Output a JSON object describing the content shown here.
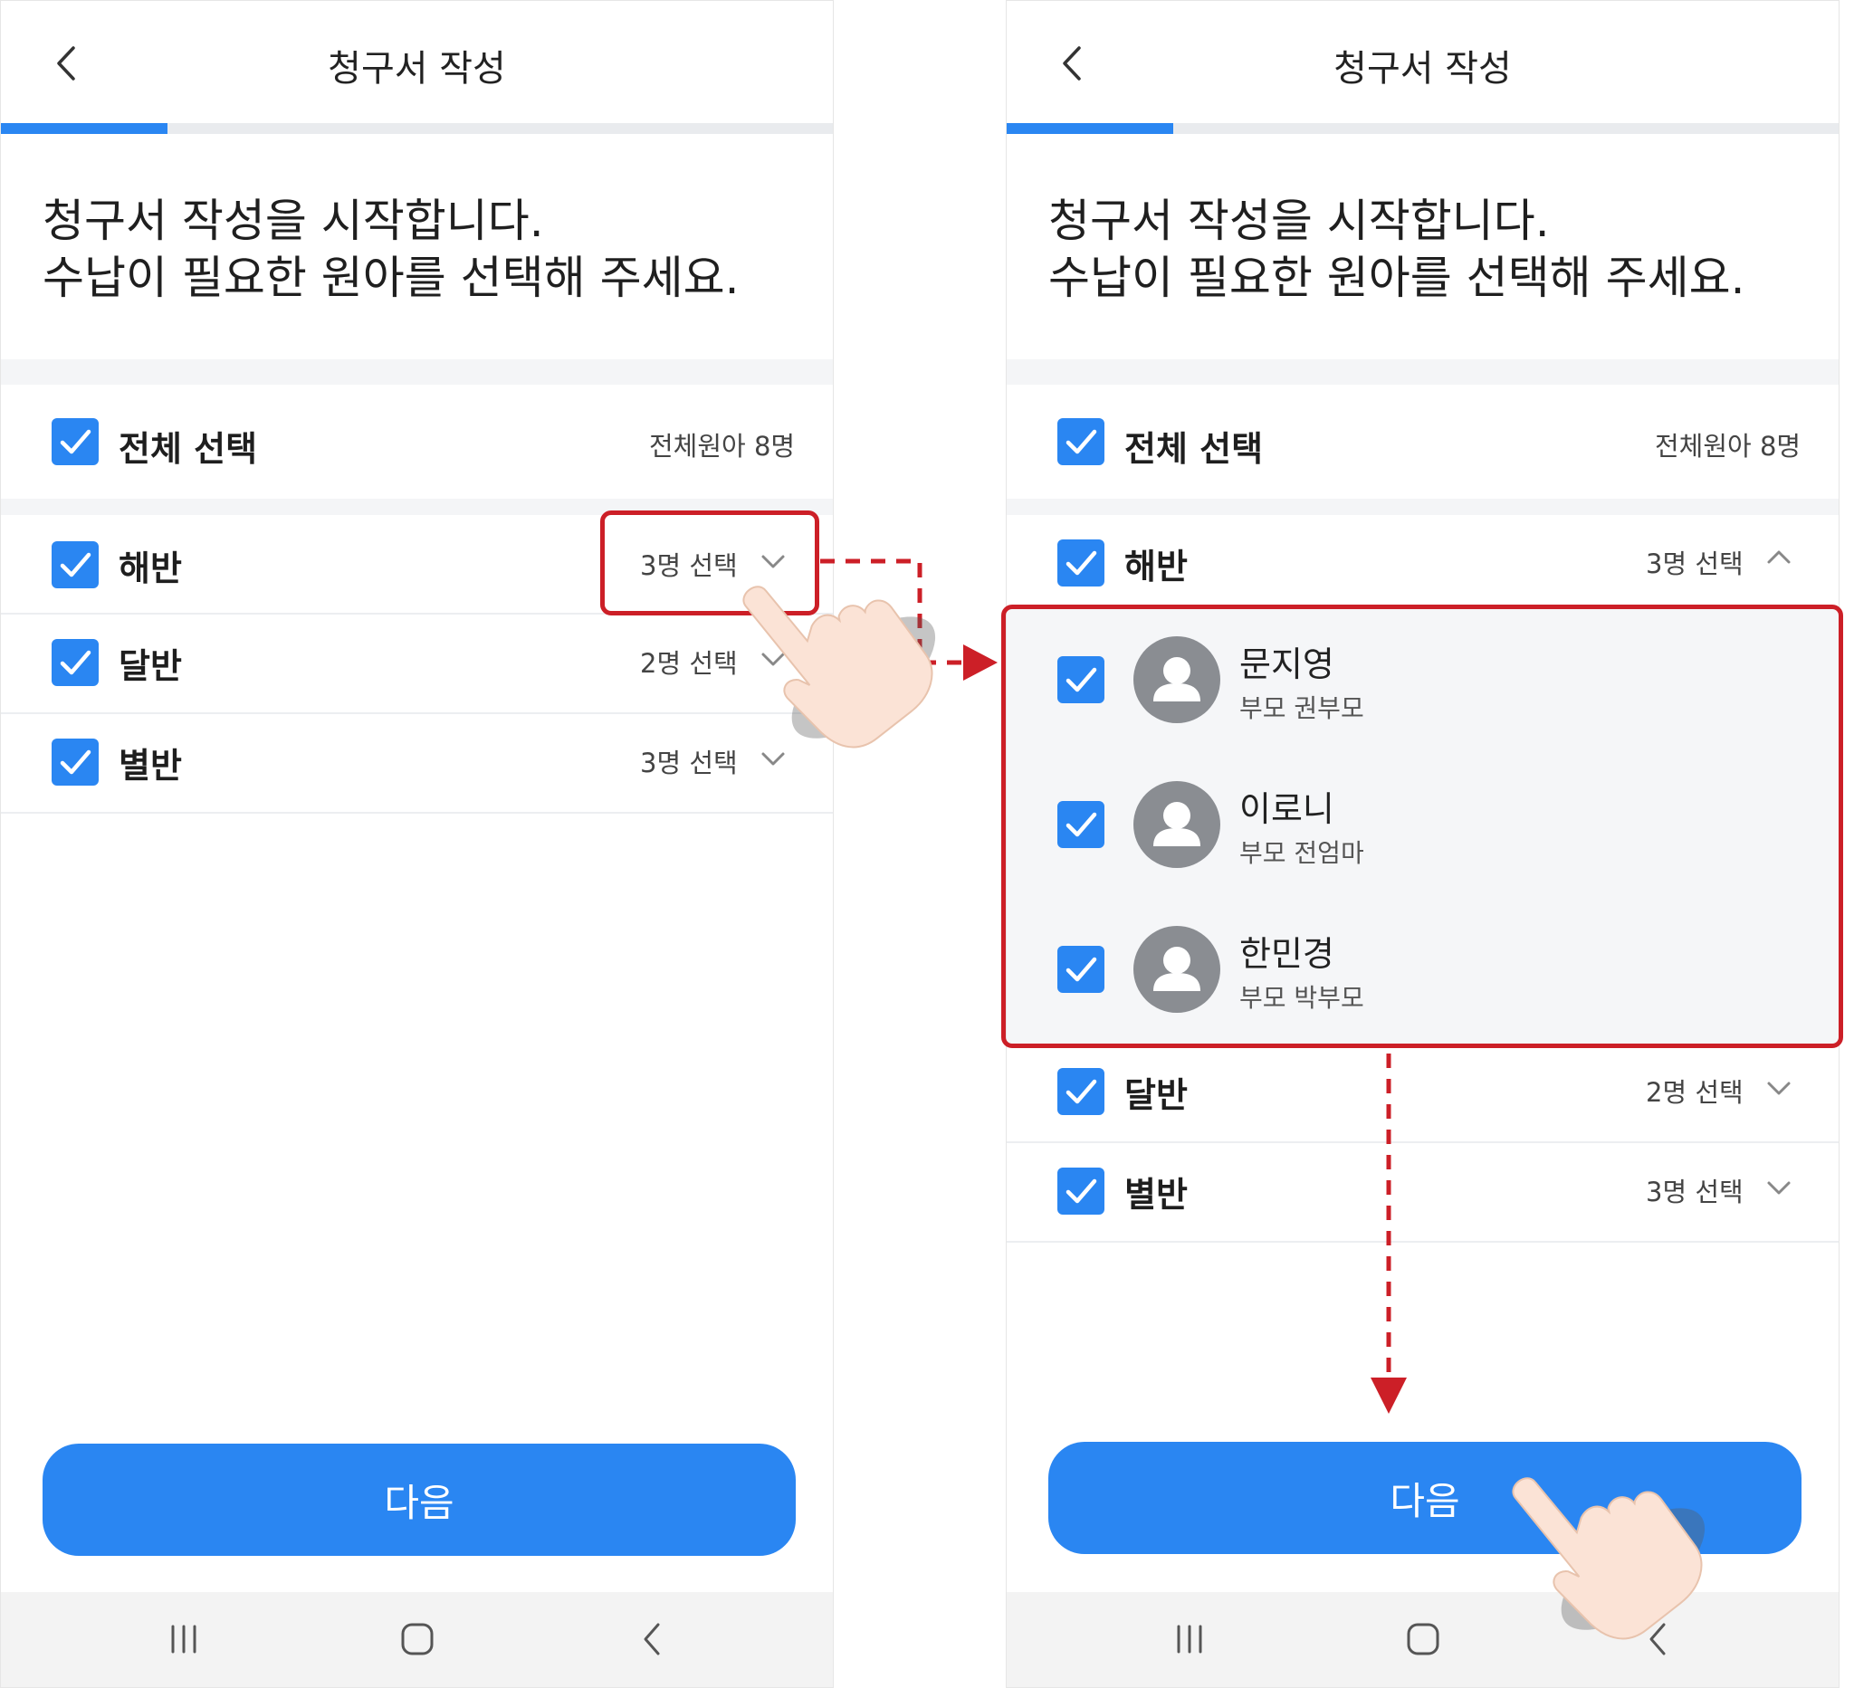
{
  "left_screen": {
    "header": {
      "title": "청구서 작성"
    },
    "progress": {
      "fraction": 0.2
    },
    "intro": {
      "line1": "청구서 작성을 시작합니다.",
      "line2": "수납이 필요한 원아를 선택해 주세요."
    },
    "select_all": {
      "label": "전체 선택",
      "total": "전체원아 8명",
      "checked": true
    },
    "classes": [
      {
        "label": "해반",
        "count": "3명 선택",
        "checked": true,
        "expanded": false
      },
      {
        "label": "달반",
        "count": "2명 선택",
        "checked": true,
        "expanded": false
      },
      {
        "label": "별반",
        "count": "3명 선택",
        "checked": true,
        "expanded": false
      }
    ],
    "next_button": "다음"
  },
  "right_screen": {
    "header": {
      "title": "청구서 작성"
    },
    "progress": {
      "fraction": 0.2
    },
    "intro": {
      "line1": "청구서 작성을 시작합니다.",
      "line2": "수납이 필요한 원아를 선택해 주세요."
    },
    "select_all": {
      "label": "전체 선택",
      "total": "전체원아 8명",
      "checked": true
    },
    "classes": [
      {
        "label": "해반",
        "count": "3명 선택",
        "checked": true,
        "expanded": true
      },
      {
        "label": "달반",
        "count": "2명 선택",
        "checked": true,
        "expanded": false
      },
      {
        "label": "별반",
        "count": "3명 선택",
        "checked": true,
        "expanded": false
      }
    ],
    "children": [
      {
        "name": "문지영",
        "parent": "부모 권부모",
        "checked": true
      },
      {
        "name": "이로니",
        "parent": "부모 전엄마",
        "checked": true
      },
      {
        "name": "한민경",
        "parent": "부모 박부모",
        "checked": true
      }
    ],
    "next_button": "다음"
  },
  "colors": {
    "accent": "#2a86f2",
    "highlight": "#cc1f27",
    "panel_bg": "#f5f6f8",
    "avatar": "#8a8d92"
  },
  "icons": [
    "back-arrow-icon",
    "checkbox-checked-icon",
    "chevron-down-icon",
    "chevron-up-icon",
    "avatar-icon",
    "nav-recent-apps-icon",
    "nav-home-icon",
    "nav-back-icon",
    "hand-pointer-icon"
  ]
}
